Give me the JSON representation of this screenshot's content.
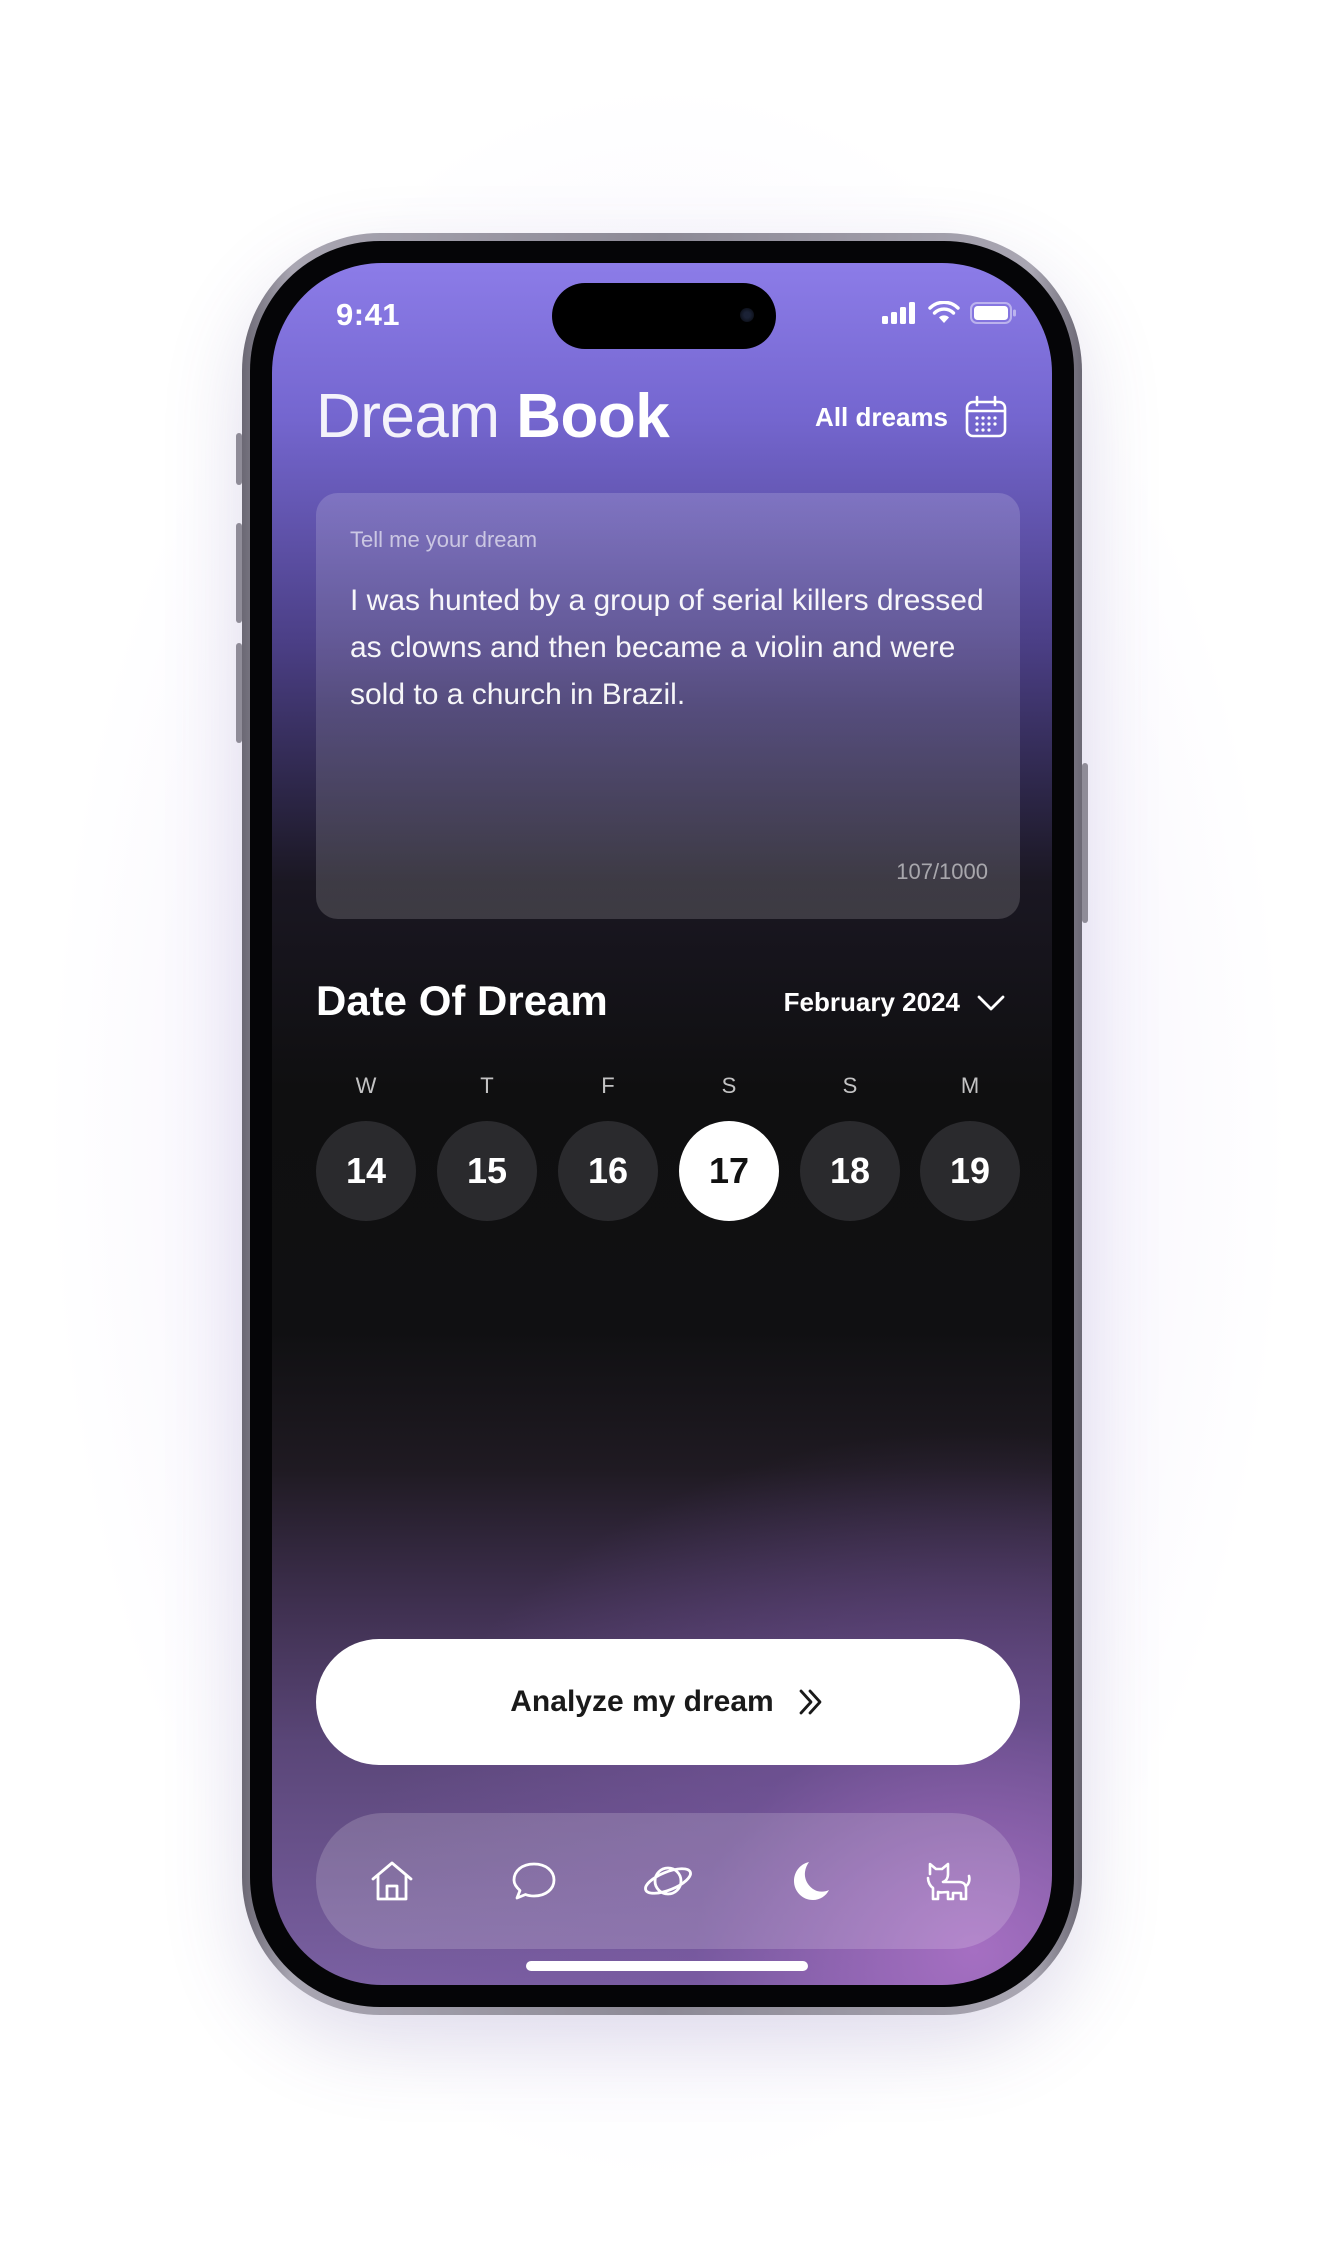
{
  "status_bar": {
    "time": "9:41"
  },
  "header": {
    "title_part1": "Dream",
    "title_part2": "Book",
    "all_dreams_label": "All dreams",
    "calendar_icon": "calendar-icon"
  },
  "dream_input": {
    "label": "Tell me your dream",
    "text": "I was hunted by a group of serial killers dressed as clowns and then became a violin and were sold to a church in Brazil.",
    "counter": "107/1000"
  },
  "date_section": {
    "title": "Date Of Dream",
    "month": "February 2024",
    "days": [
      {
        "letter": "W",
        "number": "14",
        "selected": false
      },
      {
        "letter": "T",
        "number": "15",
        "selected": false
      },
      {
        "letter": "F",
        "number": "16",
        "selected": false
      },
      {
        "letter": "S",
        "number": "17",
        "selected": true
      },
      {
        "letter": "S",
        "number": "18",
        "selected": false
      },
      {
        "letter": "M",
        "number": "19",
        "selected": false
      }
    ]
  },
  "cta": {
    "label": "Analyze my dream",
    "icon": "double-chevron-right-icon"
  },
  "tabbar": {
    "items": [
      {
        "icon": "home-icon",
        "active": false
      },
      {
        "icon": "chat-bubble-icon",
        "active": false
      },
      {
        "icon": "planet-icon",
        "active": false
      },
      {
        "icon": "moon-icon",
        "active": true
      },
      {
        "icon": "cat-icon",
        "active": false
      }
    ]
  },
  "colors": {
    "gradient_top": "#8c7ce8",
    "background_dark": "#0f0f10",
    "gradient_bottom": "#7a60a2",
    "selected_day": "#ffffff",
    "day_circle": "#2a2a2d"
  }
}
